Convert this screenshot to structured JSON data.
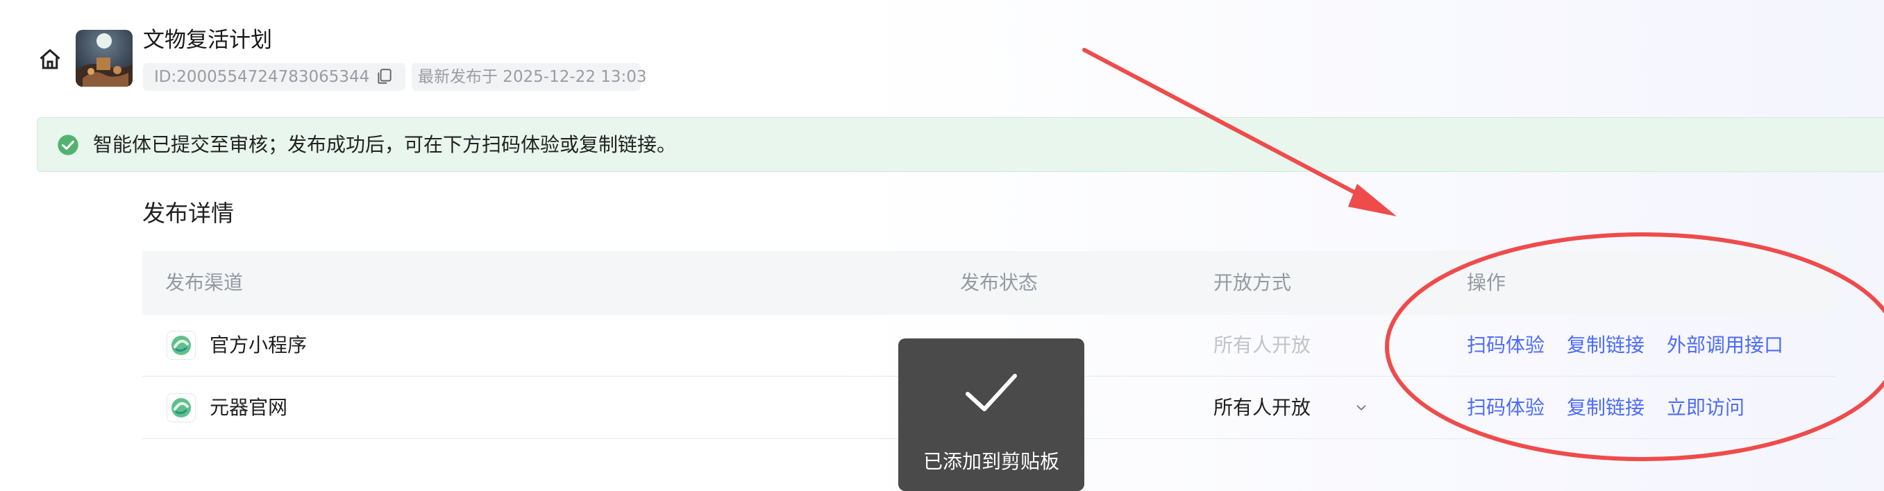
{
  "header": {
    "title": "文物复活计划",
    "id_label": "ID:2000554724783065344",
    "published": "最新发布于 2025-12-22 13:03"
  },
  "banner": {
    "message": "智能体已提交至审核；发布成功后，可在下方扫码体验或复制链接。"
  },
  "section": {
    "title": "发布详情",
    "columns": [
      "发布渠道",
      "发布状态",
      "开放方式",
      "操作"
    ],
    "rows": [
      {
        "channel": "官方小程序",
        "access": "所有人开放",
        "actions": [
          "扫码体验",
          "复制链接",
          "外部调用接口"
        ]
      },
      {
        "channel": "元器官网",
        "access": "所有人开放",
        "actions": [
          "扫码体验",
          "复制链接",
          "立即访问"
        ]
      }
    ]
  },
  "toast": {
    "message": "已添加到剪贴板"
  },
  "colors": {
    "link": "#4d6bfe",
    "success": "#52b36f",
    "annotation": "#ef4b4b"
  },
  "icons": [
    "home-icon",
    "copy-icon",
    "check-circle-icon",
    "channel-logo-icon",
    "chevron-down-icon",
    "check-icon"
  ]
}
